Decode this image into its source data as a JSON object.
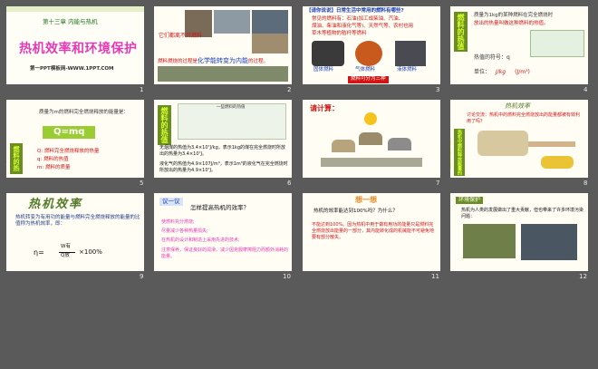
{
  "slides": [
    {
      "number": "1",
      "chapter": "第十三章 内能与热机",
      "title": "热机效率和环境保护",
      "footer": "第一PPT模板网-WWW.1PPT.COM"
    },
    {
      "number": "2",
      "caption1": "它们都离不开燃料",
      "caption2_pre": "燃料燃烧的过程是",
      "caption2_hl": "化学能转变为内能",
      "caption2_post": "的过程。"
    },
    {
      "number": "3",
      "header": "【请你说说】日常生活中常用的燃料有哪些?",
      "lines": [
        "常见的燃料有：石油(加工成柴油、汽油、",
        "煤油、柴油和液化气等)、天然气等、农村也用",
        "草木等植物的秸秆等燃料"
      ],
      "labels": [
        "固体燃料",
        "气体燃料",
        "液体燃料"
      ],
      "footer": "燃料可分为三种"
    },
    {
      "number": "4",
      "bar": "燃料的热值",
      "lines": [
        "质量为1kg的某种燃料在完全燃烧时",
        "放出的热量叫做这种燃料的热值。",
        "单位：J/kg",
        "热值的符号：q"
      ],
      "unit_label": "单位：",
      "unit": "J/kg",
      "vol_unit": "(J/m³)"
    },
    {
      "number": "5",
      "intro": "质量为m的燃料完全燃烧释放的能量是：",
      "formula": "Q=mq",
      "items": [
        "Q: 燃料完全燃烧释放的热量",
        "q: 燃料的热值",
        "m: 燃料的质量"
      ],
      "bar": "燃料的热值"
    },
    {
      "number": "6",
      "bar": "燃料的热值",
      "table_title": "一些燃料的热值",
      "para1": "无烟煤的热值为3.4×10⁷J/kg，表示1kg的煤在完全燃烧时所放出的热量为3.4×10⁷J。",
      "para2": "液化气的热值为4.9×107J/m³，表示1m³的液化气在完全燃烧时所放出的热量为4.9×10⁷J。"
    },
    {
      "number": "7",
      "title": "请计算："
    },
    {
      "number": "8",
      "title": "热机效率",
      "q": "讨论交流：热机中的燃料完全燃烧放出的能量都被有效利用了吗？",
      "bar": "热机中燃料释放能量的主要去向示意图"
    },
    {
      "number": "9",
      "title": "热机效率",
      "def": "热机转变为有用功的能量与燃料完全燃烧释放的能量的比值称为热机效率，即：",
      "eta": "η=",
      "num": "W有",
      "den": "Q放",
      "pct": "×100%"
    },
    {
      "number": "10",
      "tag": "议一议",
      "title": "怎样提高热机的效率？",
      "items": [
        "使燃料充分燃烧;",
        "尽量减少各种热量损失;",
        "在热机的设计和制造上采用先进的技术;",
        "注意保养，保证良好的润滑，减少因克服摩擦阻力而额外消耗的能量。"
      ]
    },
    {
      "number": "11",
      "tag": "想一想",
      "q": "热机的效率能达到100%吗？为什么？",
      "ans": "不能达到100%。因为热机中用于做有用功的能量只是燃料完全燃烧放出能量的一部分，其内能转化成的机械能不可避免地要有部分散失。"
    },
    {
      "number": "12",
      "tag": "环境保护",
      "text": "热机为人类的发展做出了重大贡献，但也带来了许多环境污染问题："
    }
  ],
  "colors": {
    "slide_bg": "#fffdf4",
    "green": "#1e7b1e",
    "red": "#d31414",
    "page_bg": "#5a5a5a"
  }
}
